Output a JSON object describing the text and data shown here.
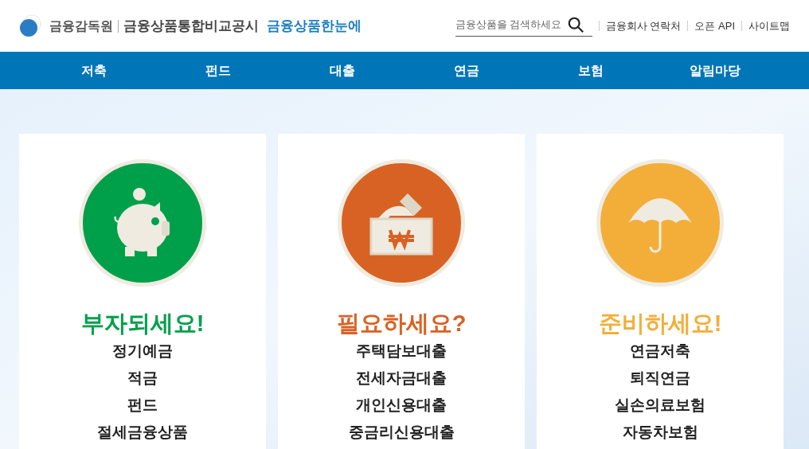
{
  "header": {
    "org": "금융감독원",
    "site": "금융상품통합비교공시",
    "brand": "금융상품한눈에",
    "search": {
      "placeholder": "금융상품을 검색하세요"
    },
    "links": [
      "금융회사 연락처",
      "오픈 API",
      "사이트맵"
    ]
  },
  "nav": [
    "저축",
    "펀드",
    "대출",
    "연금",
    "보험",
    "알림마당"
  ],
  "cards": [
    {
      "kind": "piggy",
      "title": "부자되세요!",
      "color": "#00a04b",
      "items": [
        "정기예금",
        "적금",
        "펀드",
        "절세금융상품"
      ]
    },
    {
      "kind": "box",
      "title": "필요하세요?",
      "color": "#d86224",
      "items": [
        "주택담보대출",
        "전세자금대출",
        "개인신용대출",
        "중금리신용대출"
      ]
    },
    {
      "kind": "umbrella",
      "title": "준비하세요!",
      "color": "#f3ae3a",
      "items": [
        "연금저축",
        "퇴직연금",
        "실손의료보험",
        "자동차보험"
      ]
    }
  ]
}
